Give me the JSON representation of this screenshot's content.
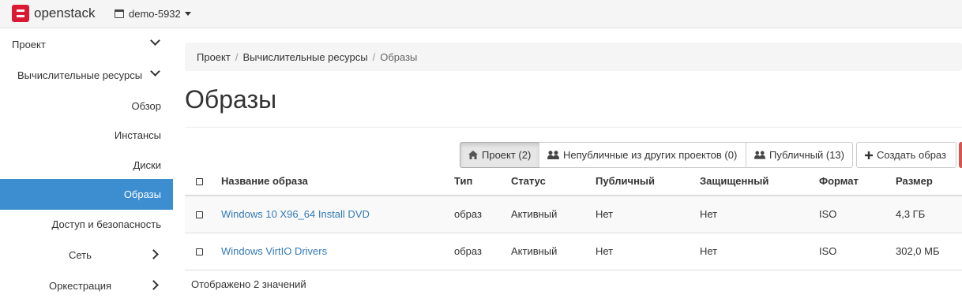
{
  "topbar": {
    "logo": "openstack",
    "project_selector": "demo-5932"
  },
  "sidebar": {
    "items": [
      {
        "label": "Проект",
        "level": 0,
        "expander": "down"
      },
      {
        "label": "Вычислительные ресурсы",
        "level": 1,
        "expander": "down"
      },
      {
        "label": "Обзор",
        "level": 2
      },
      {
        "label": "Инстансы",
        "level": 2
      },
      {
        "label": "Диски",
        "level": 2
      },
      {
        "label": "Образы",
        "level": 2,
        "active": true
      },
      {
        "label": "Доступ и безопасность",
        "level": 2
      },
      {
        "label": "Сеть",
        "level": 1,
        "expander": "right"
      },
      {
        "label": "Оркестрация",
        "level": 1,
        "expander": "right"
      }
    ]
  },
  "breadcrumb": {
    "items": [
      "Проект",
      "Вычислительные ресурсы",
      "Образы"
    ]
  },
  "page_title": "Образы",
  "filters": {
    "project": "Проект (2)",
    "shared": "Непубличные из других проектов (0)",
    "public": "Публичный (13)",
    "create": "Создать образ"
  },
  "table": {
    "headers": [
      "Название образа",
      "Тип",
      "Статус",
      "Публичный",
      "Защищенный",
      "Формат",
      "Размер"
    ],
    "rows": [
      {
        "name": "Windows 10 X96_64 Install DVD",
        "type": "образ",
        "status": "Активный",
        "public": "Нет",
        "protected": "Нет",
        "format": "ISO",
        "size": "4,3 ГБ"
      },
      {
        "name": "Windows VirtIO Drivers",
        "type": "образ",
        "status": "Активный",
        "public": "Нет",
        "protected": "Нет",
        "format": "ISO",
        "size": "302,0 МБ"
      }
    ]
  },
  "footer": "Отображено 2 значений"
}
